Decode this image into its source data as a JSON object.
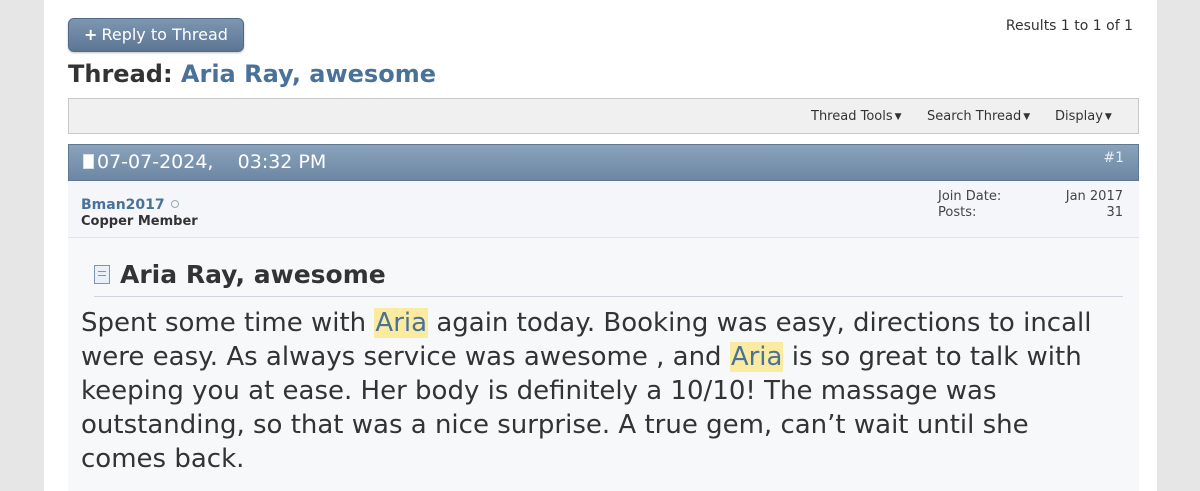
{
  "toolbar": {
    "reply_label": "Reply to Thread",
    "reply_icon": "plus-icon",
    "results": "Results 1 to 1 of 1"
  },
  "thread": {
    "prefix": "Thread:",
    "title": "Aria Ray, awesome"
  },
  "tools": {
    "thread_tools": "Thread Tools",
    "search_thread": "Search Thread",
    "display": "Display"
  },
  "post": {
    "date": "07-07-2024,",
    "time": "03:32 PM",
    "number": "#1",
    "username": "Bman2017",
    "usertitle": "Copper Member",
    "join_label": "Join Date:",
    "join_value": "Jan 2017",
    "posts_label": "Posts:",
    "posts_value": "31",
    "title": "Aria Ray, awesome",
    "text_parts": [
      "Spent some time with ",
      "Aria",
      " again today. Booking was easy, directions to incall were easy. As always service was awesome , and ",
      "Aria",
      " is so great to talk with keeping you at ease. Her body is definitely a 10/10! The massage was outstanding, so that was a nice surprise. A true gem, can’t wait until she comes back."
    ]
  },
  "colors": {
    "accent": "#4a7299",
    "header_bar": "#7a92ad",
    "highlight": "#fbeba0"
  }
}
